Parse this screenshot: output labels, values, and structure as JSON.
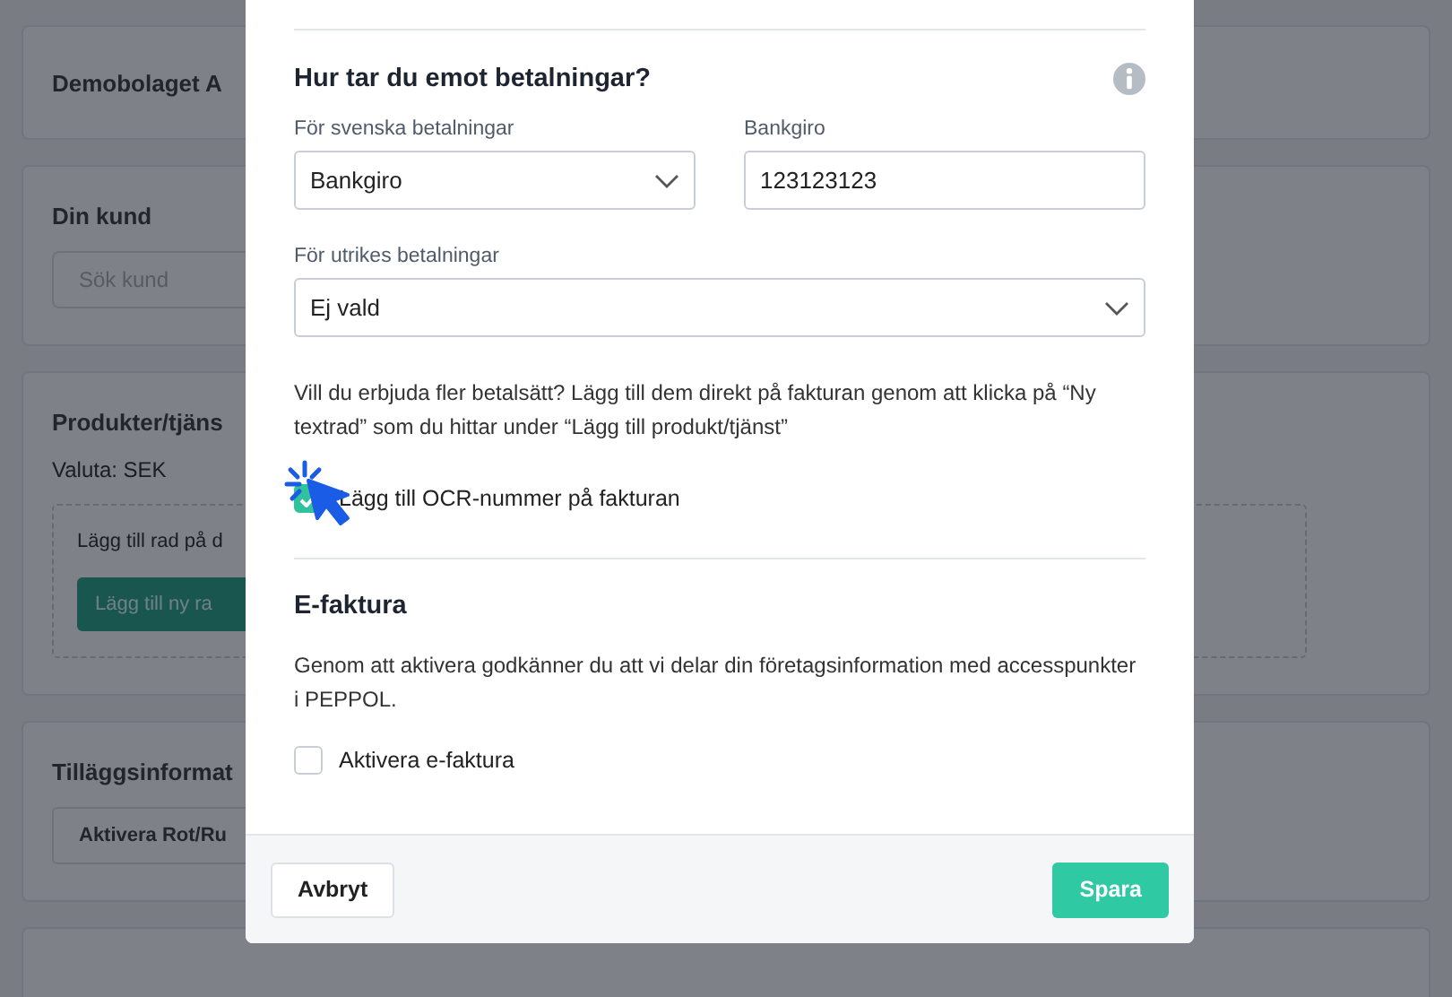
{
  "background_page": {
    "company_card": {
      "title": "Demobolaget A"
    },
    "customer_card": {
      "title": "Din kund",
      "search": {
        "placeholder": "Sök kund"
      }
    },
    "products_card": {
      "title": "Produkter/tjäns",
      "currency": "Valuta: SEK",
      "empty_box": {
        "text": "Lägg till rad på d",
        "button": "Lägg till ny ra"
      }
    },
    "extra_card": {
      "title": "Tilläggsinformat",
      "button": "Aktivera Rot/Ru"
    }
  },
  "modal": {
    "payment_section": {
      "title": "Hur tar du emot betalningar?",
      "swedish": {
        "label": "För svenska betalningar",
        "value": "Bankgiro"
      },
      "bankgiro": {
        "label": "Bankgiro",
        "value": "123123123"
      },
      "foreign": {
        "label": "För utrikes betalningar",
        "value": "Ej vald"
      },
      "info_text": "Vill du erbjuda fler betalsätt? Lägg till dem direkt på fakturan genom att klicka på “Ny textrad” som du hittar under “Lägg till produkt/tjänst”",
      "ocr_checkbox": {
        "label": "Lägg till OCR-nummer på fakturan",
        "checked": true
      }
    },
    "einvoice_section": {
      "title": "E-faktura",
      "text": "Genom att aktivera godkänner du att vi delar din företagsinformation med accesspunkter i PEPPOL.",
      "checkbox": {
        "label": "Aktivera e-faktura",
        "checked": false
      }
    },
    "footer": {
      "cancel": "Avbryt",
      "save": "Spara"
    }
  }
}
